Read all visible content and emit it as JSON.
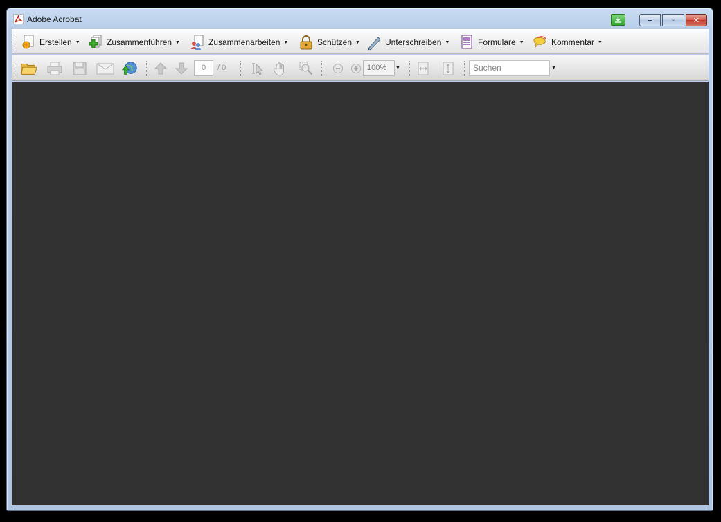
{
  "window": {
    "title": "Adobe Acrobat",
    "caption_buttons": {
      "minimize": "–",
      "restore": "▫",
      "close": "✕"
    }
  },
  "menubar": {
    "items": [
      {
        "label": "Erstellen",
        "icon": "create-pdf-icon"
      },
      {
        "label": "Zusammenführen",
        "icon": "combine-files-icon"
      },
      {
        "label": "Zusammenarbeiten",
        "icon": "collaborate-icon"
      },
      {
        "label": "Schützen",
        "icon": "lock-icon"
      },
      {
        "label": "Unterschreiben",
        "icon": "pen-sign-icon"
      },
      {
        "label": "Formulare",
        "icon": "forms-icon"
      },
      {
        "label": "Kommentar",
        "icon": "comment-bubble-icon"
      }
    ]
  },
  "toolbar": {
    "page_current": "0",
    "page_total": "/ 0",
    "zoom": "100%",
    "search_placeholder": "Suchen"
  },
  "colors": {
    "document_background": "#323232",
    "window_frame": "#b7cde8"
  }
}
